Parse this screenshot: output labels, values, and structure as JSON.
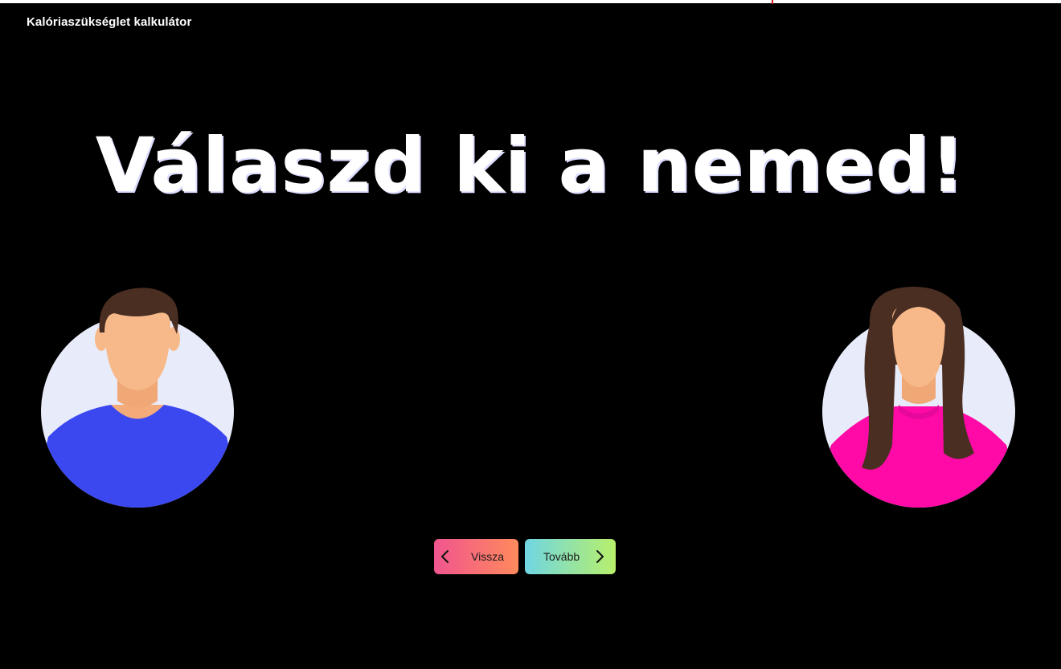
{
  "app": {
    "title": "Kalóriaszükséglet kalkulátor"
  },
  "main": {
    "heading": "Válaszd ki a nemed!"
  },
  "gender_options": [
    {
      "id": "male",
      "icon": "male-avatar-icon",
      "shirt_color": "#3b48f0"
    },
    {
      "id": "female",
      "icon": "female-avatar-icon",
      "shirt_color": "#ff0aa6"
    }
  ],
  "navigation": {
    "back_label": "Vissza",
    "next_label": "Tovább",
    "back_icon": "chevron-left-icon",
    "next_icon": "chevron-right-icon"
  },
  "colors": {
    "background": "#000000",
    "avatar_bg": "#e8ecfa",
    "skin": "#f7b98a",
    "back_gradient": [
      "#f0558f",
      "#ff8a5c"
    ],
    "next_gradient": [
      "#6fd6e3",
      "#b8ef6a"
    ]
  }
}
